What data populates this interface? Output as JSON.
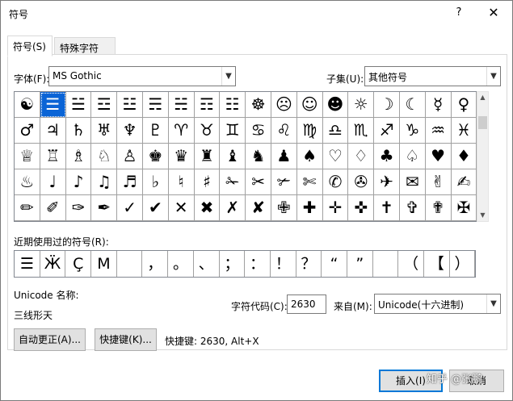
{
  "window": {
    "title": "符号",
    "help": "?",
    "close": "✕"
  },
  "tabs": [
    {
      "label": "符号(S)"
    },
    {
      "label": "特殊字符(P)"
    }
  ],
  "font": {
    "label": "字体(F):",
    "value": "MS Gothic"
  },
  "subset": {
    "label": "子集(U):",
    "value": "其他符号"
  },
  "symbol_grid": [
    [
      "☯",
      "☰",
      "☱",
      "☲",
      "☳",
      "☴",
      "☵",
      "☶",
      "☷",
      "☸",
      "☹",
      "☺",
      "☻",
      "☼",
      "☽",
      "☾",
      "☿",
      "♀",
      "♁"
    ],
    [
      "♂",
      "♃",
      "♄",
      "♅",
      "♆",
      "♇",
      "♈",
      "♉",
      "♊",
      "♋",
      "♌",
      "♍",
      "♎",
      "♏",
      "♐",
      "♑",
      "♒",
      "♓",
      "♔"
    ],
    [
      "♕",
      "♖",
      "♗",
      "♘",
      "♙",
      "♚",
      "♛",
      "♜",
      "♝",
      "♞",
      "♟",
      "♠",
      "♡",
      "♢",
      "♣",
      "♤",
      "♥",
      "♦",
      "♧"
    ],
    [
      "♨",
      "♩",
      "♪",
      "♫",
      "♬",
      "♭",
      "♮",
      "♯",
      "✁",
      "✂",
      "✃",
      "✄",
      "✆",
      "✇",
      "✈",
      "✉",
      "✌",
      "✍",
      "✎"
    ],
    [
      "✏",
      "✐",
      "✑",
      "✒",
      "✓",
      "✔",
      "✕",
      "✖",
      "✗",
      "✘",
      "✙",
      "✚",
      "✛",
      "✜",
      "✝",
      "✞",
      "✟",
      "✠",
      "✡"
    ]
  ],
  "recent": {
    "label": "近期使用过的符号(R):",
    "symbols": [
      "☰",
      "Ӝ",
      "Ç",
      "M",
      "",
      "，",
      "。",
      "、",
      "；",
      "：",
      "！",
      "？",
      "“",
      "”",
      "",
      "（",
      "【",
      "）",
      "%",
      "&"
    ]
  },
  "unicode_name": {
    "label": "Unicode 名称:",
    "value": "三线形天"
  },
  "char_code": {
    "label": "字符代码(C):",
    "value": "2630"
  },
  "from": {
    "label": "来自(M):",
    "value": "Unicode(十六进制)"
  },
  "buttons": {
    "autocorrect": "自动更正(A)...",
    "shortcut_key": "快捷键(K)...",
    "shortcut_text": "快捷键: 2630, Alt+X",
    "insert": "插入(I)",
    "cancel": "取消"
  },
  "watermark": "知乎 @张鹏"
}
